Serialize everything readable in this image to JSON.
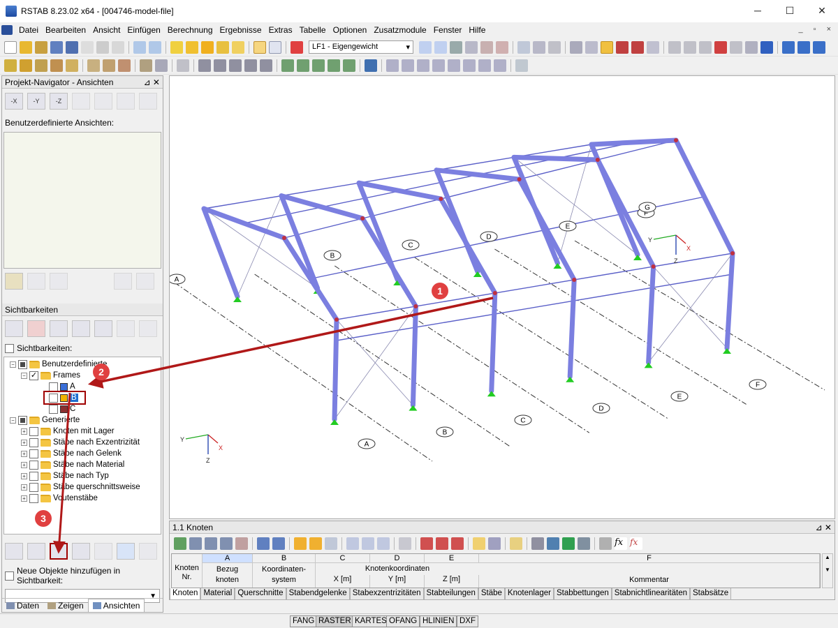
{
  "window": {
    "title": "RSTAB 8.23.02 x64 - [004746-model-file]",
    "minimize": "─",
    "maximize": "☐",
    "close": "✕"
  },
  "menu": [
    "Datei",
    "Bearbeiten",
    "Ansicht",
    "Einfügen",
    "Berechnung",
    "Ergebnisse",
    "Extras",
    "Tabelle",
    "Optionen",
    "Zusatzmodule",
    "Fenster",
    "Hilfe"
  ],
  "mdi_controls": "_ ▫ ×",
  "toolbar": {
    "loadcase": "LF1 - Eigengewicht",
    "dropdown": "▾"
  },
  "navigator": {
    "title": "Projekt-Navigator - Ansichten",
    "pin": "⊿ ✕",
    "custom_views_label": "Benutzerdefinierte Ansichten:",
    "view_buttons": [
      "-X",
      "-Y",
      "-Z"
    ],
    "sichtbarkeiten_title": "Sichtbarkeiten",
    "sichtbarkeiten_check": "Sichtbarkeiten:",
    "tree": {
      "root1": "Benutzerdefinierte",
      "frames": "Frames",
      "items": [
        {
          "label": "A",
          "color": "#3a6fd8"
        },
        {
          "label": "B",
          "color": "#f0b400"
        },
        {
          "label": "C",
          "color": "#8a3030"
        }
      ],
      "root2": "Generierte",
      "generated": [
        "Knoten mit Lager",
        "Stäbe nach Exzentrizität",
        "Stäbe nach Gelenk",
        "Stäbe nach Material",
        "Stäbe nach Typ",
        "Stäbe querschnittsweise",
        "Voutenstäbe"
      ]
    },
    "new_objects": "Neue Objekte hinzufügen in Sichtbarkeit:",
    "tabs": [
      "Daten",
      "Zeigen",
      "Ansichten"
    ]
  },
  "viewport": {
    "axis_labels": [
      "A",
      "B",
      "C",
      "D",
      "E",
      "F",
      "G"
    ],
    "callouts": [
      "1",
      "2",
      "3"
    ],
    "coord": {
      "y": "Y",
      "x": "X",
      "z": "Z"
    },
    "colors": {
      "member": "#7b7fe0",
      "member_edge": "#5a5fc8",
      "support": "#22cc22",
      "arrow": "#b01818",
      "callout": "#e04040"
    }
  },
  "table": {
    "title": "1.1 Knoten",
    "columns": [
      "A",
      "B",
      "C",
      "D",
      "E",
      "F"
    ],
    "h1": {
      "knoten": "Knoten",
      "nr": "Nr.",
      "bezug": "Bezug",
      "knoten2": "knoten",
      "koord": "Koordinaten-",
      "system": "system",
      "kk": "Knotenkoordinaten",
      "x": "X [m]",
      "y": "Y [m]",
      "z": "Z [m]",
      "kommentar": "Kommentar"
    },
    "tabs": [
      "Knoten",
      "Material",
      "Querschnitte",
      "Stabendgelenke",
      "Stabexzentrizitäten",
      "Stabteilungen",
      "Stäbe",
      "Knotenlager",
      "Stabbettungen",
      "Stabnichtlinearitäten",
      "Stabsätze"
    ]
  },
  "status": [
    "FANG",
    "RASTER",
    "KARTES",
    "OFANG",
    "HLINIEN",
    "DXF"
  ]
}
